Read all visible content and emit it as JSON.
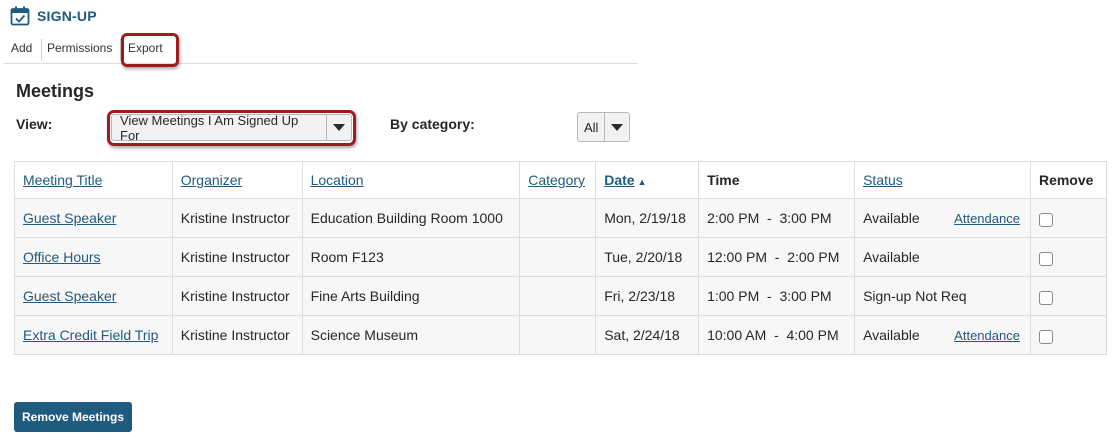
{
  "tool": {
    "title": "SIGN-UP",
    "icon": "calendar-check-icon"
  },
  "toolbar": {
    "items": [
      "Add",
      "Permissions",
      "Export"
    ],
    "highlighted": "Export"
  },
  "meetings": {
    "section_title": "Meetings",
    "view_label": "View:",
    "view_selected": "View Meetings I Am Signed Up For",
    "category_label": "By category:",
    "category_selected": "All"
  },
  "table": {
    "headers": [
      "Meeting Title",
      "Organizer",
      "Location",
      "Category",
      "Date",
      "Time",
      "Status",
      "Remove"
    ],
    "sort_indicator": "▲",
    "rows": [
      {
        "title": "Guest Speaker",
        "organizer": "Kristine Instructor",
        "location": "Education Building Room 1000",
        "category": "",
        "date": "Mon, 2/19/18",
        "time": "2:00 PM  -  3:00 PM",
        "status": "Available",
        "status_link": "Attendance"
      },
      {
        "title": "Office Hours",
        "organizer": "Kristine Instructor",
        "location": "Room F123",
        "category": "",
        "date": "Tue, 2/20/18",
        "time": "12:00 PM  -  2:00 PM",
        "status": "Available",
        "status_link": ""
      },
      {
        "title": "Guest Speaker",
        "organizer": "Kristine Instructor",
        "location": "Fine Arts Building",
        "category": "",
        "date": "Fri, 2/23/18",
        "time": "1:00 PM  -  3:00 PM",
        "status": "Sign-up Not Req",
        "status_link": ""
      },
      {
        "title": "Extra Credit Field Trip",
        "organizer": "Kristine Instructor",
        "location": "Science Museum",
        "category": "",
        "date": "Sat, 2/24/18",
        "time": "10:00 AM  -  4:00 PM",
        "status": "Available",
        "status_link": "Attendance"
      }
    ]
  },
  "actions": {
    "remove_label": "Remove Meetings"
  },
  "colors": {
    "accent": "#1f5a7f",
    "highlight_border": "#a01a1e",
    "row_bg": "#f7f7f7"
  }
}
